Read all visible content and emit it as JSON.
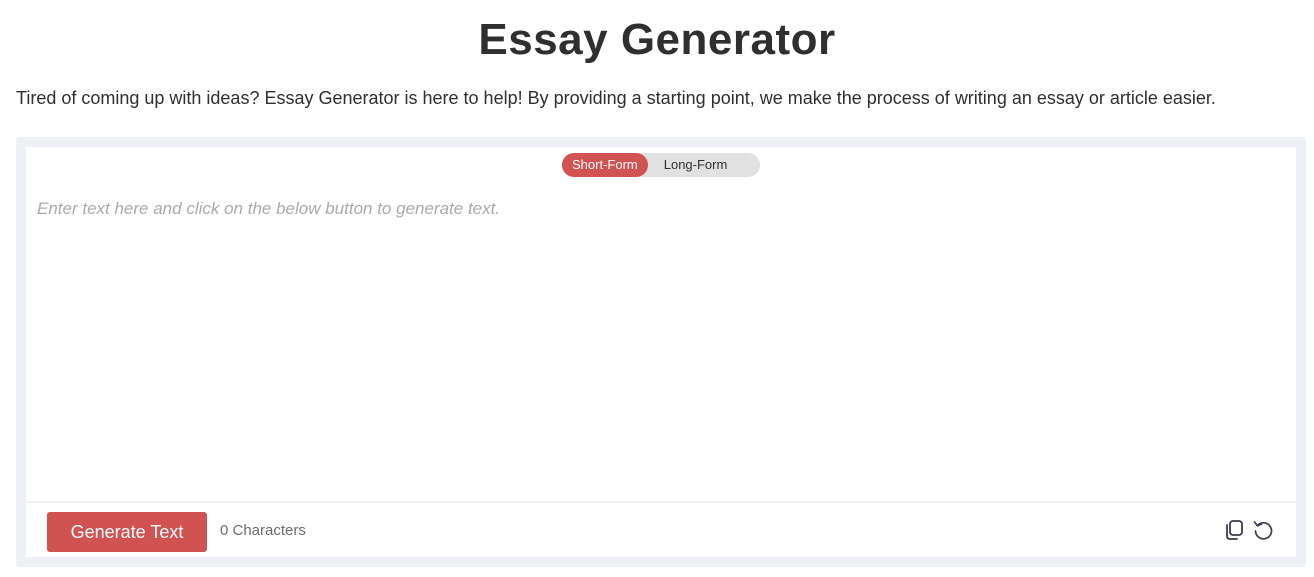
{
  "header": {
    "title": "Essay Generator",
    "description": "Tired of coming up with ideas? Essay Generator is here to help! By providing a starting point, we make the process of writing an essay or article easier."
  },
  "mode_toggle": {
    "options": [
      "Short-Form",
      "Long-Form"
    ],
    "selected": "Short-Form"
  },
  "editor": {
    "placeholder": "Enter text here and click on the below button to generate text.",
    "value": ""
  },
  "footer": {
    "generate_label": "Generate Text",
    "char_count": "0 Characters"
  },
  "icons": {
    "copy": "copy-icon",
    "reset": "reset-icon"
  },
  "colors": {
    "accent": "#d05352",
    "panel_bg": "#edf1f6",
    "toggle_bg": "#e1e1e1",
    "text": "#2f2f2f",
    "placeholder": "#aaaaaa"
  }
}
